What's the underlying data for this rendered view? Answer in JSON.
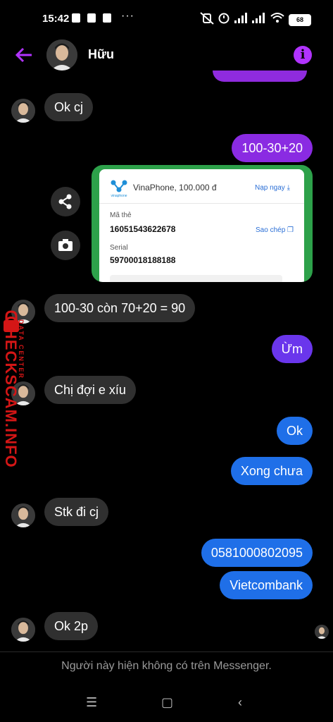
{
  "status_bar": {
    "time": "15:42",
    "more": "···",
    "battery": "68"
  },
  "header": {
    "contact_name": "Hữu",
    "info_symbol": "i"
  },
  "messages": [
    {
      "dir": "in",
      "text": "Ok cj"
    },
    {
      "dir": "out",
      "text": "100-30+20"
    },
    {
      "dir": "in",
      "text": "100-30 còn 70+20 = 90"
    },
    {
      "dir": "out",
      "text": "Ừm"
    },
    {
      "dir": "in",
      "text": "Chị đợi e xíu"
    },
    {
      "dir": "out",
      "text": "Ok"
    },
    {
      "dir": "out",
      "text": "Xong chưa"
    },
    {
      "dir": "in",
      "text": "Stk đi cj"
    },
    {
      "dir": "out",
      "text": "0581000802095"
    },
    {
      "dir": "out",
      "text": "Vietcombank"
    },
    {
      "dir": "in",
      "text": "Ok 2p"
    }
  ],
  "card": {
    "title": "VinaPhone, 100.000 đ",
    "topup_label": "Nạp ngay",
    "code_label": "Mã thẻ",
    "code_value": "16051543622678",
    "copy_label": "Sao chép",
    "serial_label": "Serial",
    "serial_value": "59700018188188",
    "logo_text": "vinaphone"
  },
  "watermark": {
    "main": "CHECKSCAM.INFO",
    "sub": "DATA CENTER"
  },
  "footer": {
    "notice": "Người này hiện không có trên Messenger."
  },
  "nav": {
    "menu": "☰",
    "home": "▢",
    "back": "‹"
  },
  "colors": {
    "outgoing_purple": "#8a2be2",
    "outgoing_blue": "#1f6fe8",
    "incoming": "#303030",
    "accent": "#b133ff",
    "watermark": "#d41616"
  }
}
